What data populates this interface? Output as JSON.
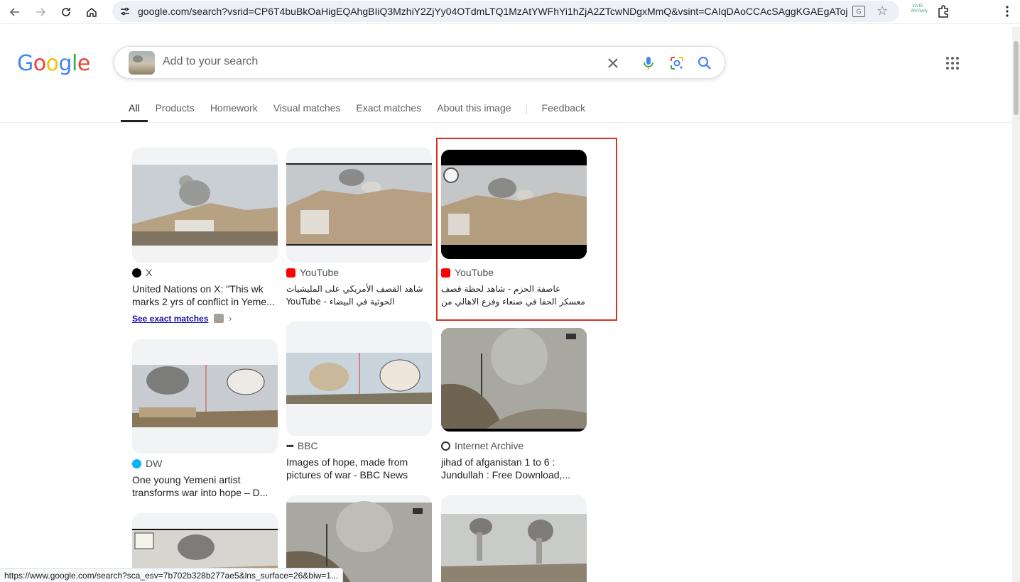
{
  "browser": {
    "url": "google.com/search?vsrid=CP6T4buBkOaHigEQAhgBIiQ3MzhiY2ZjYy04OTdmLTQ1MzAtYWFhYi1hZjA2ZTcwNDgxMmQ&vsint=CAIqDAoCCAcSAggKGAEgATojCh...",
    "status_url": "https://www.google.com/search?sca_esv=7b702b328b277ae5&lns_surface=26&biw=1...",
    "extension_label": "InVID WeVerify"
  },
  "logo": {
    "g1": "G",
    "o1": "o",
    "o2": "o",
    "g2": "g",
    "l": "l",
    "e": "e"
  },
  "search": {
    "placeholder": "Add to your search"
  },
  "tabs": [
    {
      "label": "All"
    },
    {
      "label": "Products"
    },
    {
      "label": "Homework"
    },
    {
      "label": "Visual matches"
    },
    {
      "label": "Exact matches"
    },
    {
      "label": "About this image"
    },
    {
      "label": "Feedback"
    }
  ],
  "results": [
    {
      "source": "X",
      "title": "United Nations on X: \"This wk marks 2 yrs of conflict in Yeme..."
    },
    {
      "source": "YouTube",
      "title": "شاهد القصف الأمريكي على المليشيات الحوثية في البيضاء - YouTube"
    },
    {
      "source": "YouTube",
      "title": "عاصفة الحزم - شاهد لحظة قصف معسكر الحفا في صنعاء وفزع الاهالي من صوت..."
    },
    {
      "source": "DW",
      "title": "One young Yemeni artist transforms war into hope – D..."
    },
    {
      "source": "BBC",
      "title": "Images of hope, made from pictures of war - BBC News"
    },
    {
      "source": "Internet Archive",
      "title": "jihad of afganistan 1 to 6 : Jundullah : Free Download,..."
    }
  ],
  "exact_matches_label": "See exact matches",
  "colors": {
    "google_blue": "#4285f4",
    "google_red": "#ea4335",
    "google_yellow": "#fbbc05",
    "google_green": "#34a853",
    "highlight": "#d93025",
    "youtube": "#ff0000",
    "dw": "#05b2fc",
    "link": "#1a0dab"
  }
}
